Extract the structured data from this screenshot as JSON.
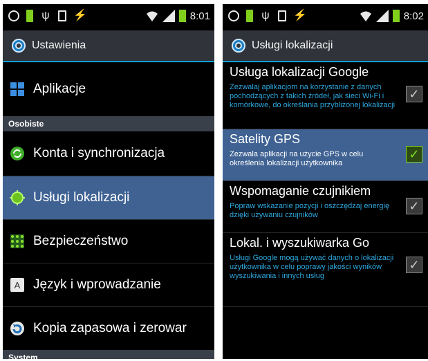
{
  "left": {
    "status": {
      "time": "8:01"
    },
    "title": "Ustawienia",
    "items": {
      "apps": "Aplikacje",
      "personal_header": "Osobiste",
      "accounts": "Konta i synchronizacja",
      "location": "Usługi lokalizacji",
      "security": "Bezpieczeństwo",
      "language": "Język i wprowadzanie",
      "backup": "Kopia zapasowa i zerowar",
      "system_header": "System"
    }
  },
  "right": {
    "status": {
      "time": "8:02"
    },
    "title": "Usługi lokalizacji",
    "options": [
      {
        "title": "Usługa lokalizacji Google",
        "desc": "Zezwalaj aplikacjom na korzystanie z danych pochodzących z takich źródeł, jak sieci Wi-Fi i komórkowe, do określania przybliżonej lokalizacji",
        "checked": false
      },
      {
        "title": "Satelity GPS",
        "desc": "Zezwala aplikacji na użycie GPS w celu określenia lokalizacji użytkownika",
        "checked": true
      },
      {
        "title": "Wspomaganie czujnikiem",
        "desc": "Popraw wskazanie pozycji i oszczędzaj energię dzięki używaniu czujników",
        "checked": false
      },
      {
        "title": "Lokal. i wyszukiwarka Go",
        "desc": "Usługi Google mogą używać danych o lokalizacji użytkownika w celu poprawy jakości wyników wyszukiwania i innych usług",
        "checked": false
      }
    ]
  },
  "icons": {
    "status_left": [
      "circle-icon",
      "battery-small-icon",
      "usb-icon",
      "sd-card-icon",
      "flash-icon"
    ],
    "status_right": [
      "wifi-icon",
      "signal-icon",
      "battery-icon"
    ]
  },
  "colors": {
    "accent": "#0aa0d9",
    "selected": "#3f6293",
    "checked": "#7fe022",
    "desc": "#2ea8de"
  }
}
